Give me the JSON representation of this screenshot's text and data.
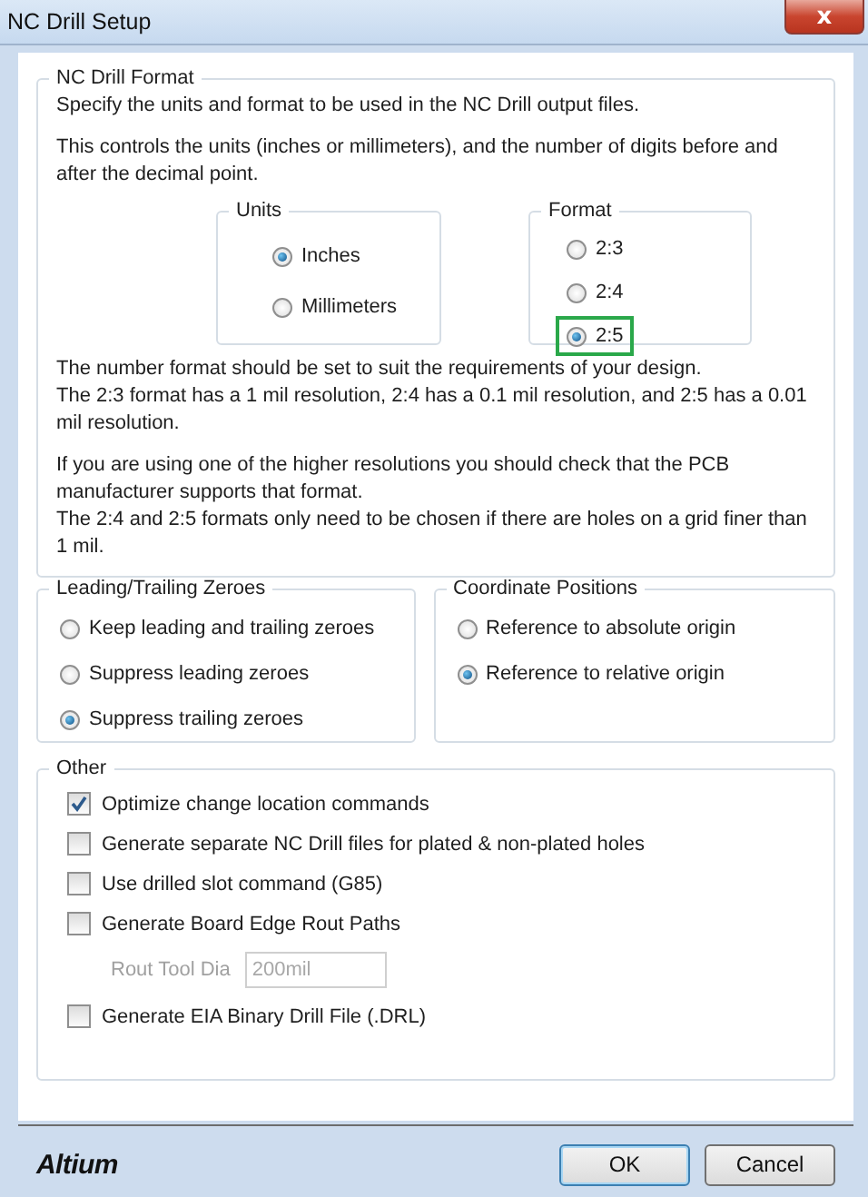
{
  "window": {
    "title": "NC Drill Setup",
    "close": "x"
  },
  "nc_drill_format": {
    "legend": "NC Drill Format",
    "intro": [
      "Specify the units and format to be used in the NC Drill output files.",
      "This controls the units (inches or millimeters), and the number of digits before and after the decimal point."
    ],
    "units": {
      "legend": "Units",
      "options": [
        {
          "label": "Inches",
          "selected": true
        },
        {
          "label": "Millimeters",
          "selected": false
        }
      ]
    },
    "format": {
      "legend": "Format",
      "options": [
        {
          "label": "2:3",
          "selected": false,
          "outlined": false
        },
        {
          "label": "2:4",
          "selected": false,
          "outlined": false
        },
        {
          "label": "2:5",
          "selected": true,
          "outlined": true
        }
      ]
    },
    "notes": [
      [
        "The number format should be set to suit the requirements of your design.",
        "The 2:3 format has a 1 mil resolution, 2:4 has a 0.1 mil resolution, and 2:5 has a 0.01 mil resolution."
      ],
      [
        "If you are using one of the higher resolutions you should check that the PCB manufacturer supports that format.",
        "The 2:4 and 2:5 formats only need to be chosen if there are holes on a grid finer than 1 mil."
      ]
    ]
  },
  "leading_trailing_zeroes": {
    "legend": "Leading/Trailing Zeroes",
    "options": [
      {
        "label": "Keep leading and trailing zeroes",
        "selected": false
      },
      {
        "label": "Suppress leading zeroes",
        "selected": false
      },
      {
        "label": "Suppress trailing zeroes",
        "selected": true
      }
    ]
  },
  "coordinate_positions": {
    "legend": "Coordinate Positions",
    "options": [
      {
        "label": "Reference to absolute origin",
        "selected": false
      },
      {
        "label": "Reference to relative origin",
        "selected": true
      }
    ]
  },
  "other": {
    "legend": "Other",
    "items": [
      {
        "kind": "checkbox",
        "label": "Optimize change location commands",
        "checked": true
      },
      {
        "kind": "checkbox",
        "label": "Generate separate NC Drill files for plated & non-plated holes",
        "checked": false
      },
      {
        "kind": "checkbox",
        "label": "Use drilled slot command (G85)",
        "checked": false
      },
      {
        "kind": "checkbox",
        "label": "Generate Board Edge Rout Paths",
        "checked": false
      },
      {
        "kind": "field",
        "label": "Rout Tool Dia",
        "value": "200mil",
        "disabled": true
      },
      {
        "kind": "checkbox",
        "label": "Generate EIA Binary Drill File (.DRL)",
        "checked": false
      }
    ]
  },
  "footer": {
    "logo": "Altium",
    "buttons": [
      {
        "label": "OK",
        "default": true
      },
      {
        "label": "Cancel",
        "default": false
      }
    ]
  }
}
